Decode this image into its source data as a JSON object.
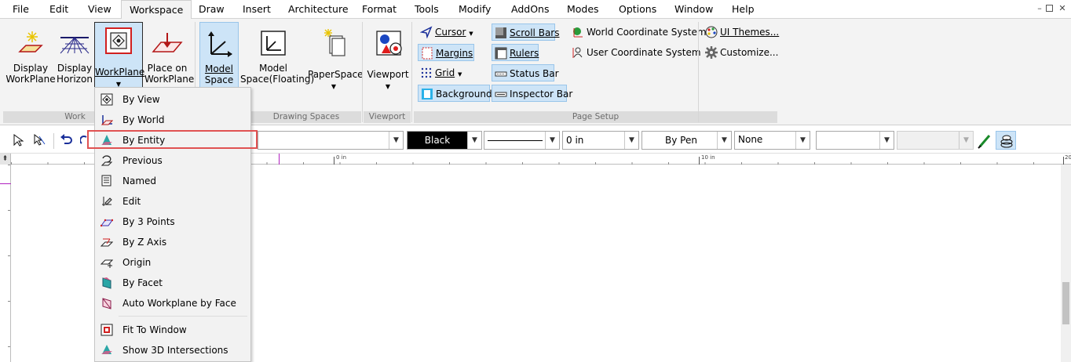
{
  "menubar": {
    "items": [
      "File",
      "Edit",
      "View",
      "Workspace",
      "Draw",
      "Insert",
      "Architecture",
      "Format",
      "Tools",
      "Modify",
      "AddOns",
      "Modes",
      "Options",
      "Window",
      "Help"
    ],
    "active": "Workspace",
    "controls": [
      "minimize-icon",
      "restore-icon",
      "close-icon"
    ]
  },
  "ribbon": {
    "workplane_group": {
      "label": "Work",
      "buttons": [
        {
          "label1": "Display",
          "label2": "WorkPlane"
        },
        {
          "label1": "Display",
          "label2": "Horizon"
        },
        {
          "label1": "WorkPlane",
          "label2": ""
        },
        {
          "label1": "Place on",
          "label2": "WorkPlane"
        }
      ]
    },
    "drawing_spaces_group": {
      "label": "Drawing Spaces",
      "buttons": [
        {
          "label1": "Model",
          "label2": "Space"
        },
        {
          "label1": "Model",
          "label2": "Space(Floating)"
        },
        {
          "label1": "PaperSpace",
          "label2": ""
        }
      ]
    },
    "viewport_group": {
      "label": "Viewport",
      "button": "Viewport"
    },
    "page_setup_group": {
      "label": "Page Setup",
      "items": [
        "Cursor",
        "Margins",
        "Grid",
        "Background",
        "Scroll Bars",
        "Rulers",
        "Status Bar",
        "Inspector Bar",
        "World Coordinate System",
        "User Coordinate System"
      ]
    },
    "ui_group": {
      "items": [
        "UI Themes...",
        "Customize..."
      ]
    }
  },
  "toolbar": {
    "color_value": "Black",
    "line_width": "0 in",
    "pen_value": "By Pen",
    "fill_value": "None"
  },
  "ruler": {
    "label_zero": "0 in",
    "label_ten": "10 in",
    "label_twenty": "20"
  },
  "workplane_menu": {
    "items": [
      {
        "label": "By View",
        "icon": "by-view-icon"
      },
      {
        "label": "By World",
        "icon": "by-world-icon"
      },
      {
        "label": "By Entity",
        "icon": "by-entity-icon"
      },
      {
        "label": "Previous",
        "icon": "previous-icon"
      },
      {
        "label": "Named",
        "icon": "named-icon"
      },
      {
        "label": "Edit",
        "icon": "edit-icon"
      },
      {
        "label": "By 3 Points",
        "icon": "three-points-icon"
      },
      {
        "label": "By Z Axis",
        "icon": "z-axis-icon"
      },
      {
        "label": "Origin",
        "icon": "origin-icon"
      },
      {
        "label": "By Facet",
        "icon": "facet-icon"
      },
      {
        "label": "Auto Workplane by Face",
        "icon": "auto-workplane-icon"
      },
      {
        "label": "Fit To Window",
        "icon": "fit-to-window-icon"
      },
      {
        "label": "Show 3D Intersections",
        "icon": "intersections-icon"
      }
    ],
    "highlighted": "By Entity"
  },
  "colors": {
    "accent_blue": "#cde4f7",
    "highlight_red": "#e05252",
    "ribbon_bg": "#f3f3f3"
  }
}
